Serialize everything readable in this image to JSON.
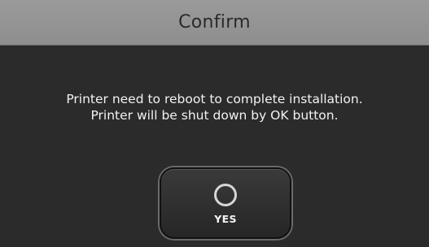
{
  "dialog": {
    "title": "Confirm",
    "message_line1": "Printer need to reboot to complete installation.",
    "message_line2": "Printer will be shut down by OK button.",
    "yes_button": {
      "label": "YES",
      "icon": "circle-icon"
    }
  },
  "colors": {
    "title_bar": "#969696",
    "background": "#2b2b2b",
    "text": "#f2f2f2"
  }
}
